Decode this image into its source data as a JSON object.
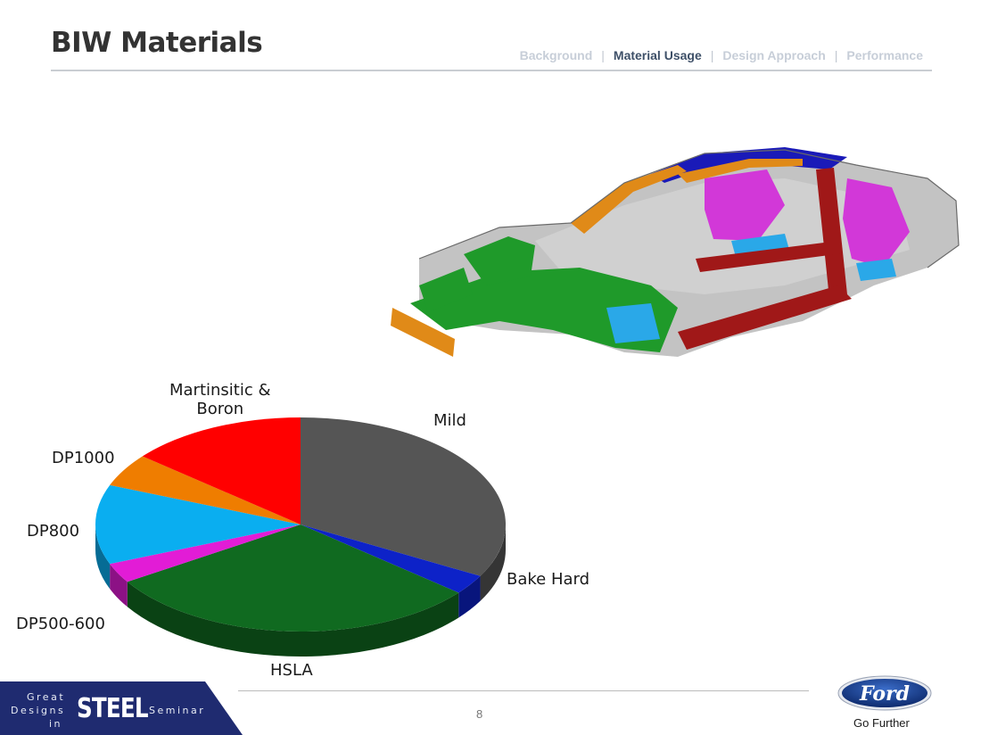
{
  "slide": {
    "title": "BIW Materials",
    "page_number": "8"
  },
  "nav": {
    "items": [
      "Background",
      "Material Usage",
      "Design Approach",
      "Performance"
    ],
    "separator": "|",
    "active_index": 1
  },
  "chart_data": {
    "type": "pie",
    "title": "",
    "style": "3d",
    "slices": [
      {
        "label": "Mild",
        "value": 33,
        "color": "#555555"
      },
      {
        "label": "Bake Hard",
        "value": 3,
        "color": "#0d22c8"
      },
      {
        "label": "HSLA",
        "value": 30,
        "color": "#106a20"
      },
      {
        "label": "DP500-600",
        "value": 3,
        "color": "#e21cd6"
      },
      {
        "label": "DP800",
        "value": 12,
        "color": "#0aaef0"
      },
      {
        "label": "DP1000",
        "value": 5,
        "color": "#ef7d00"
      },
      {
        "label": "Martinsitic &\nBoron",
        "value": 14,
        "color": "#ff0000"
      }
    ],
    "label_lines": {
      "mild": "Mild",
      "bake_hard": "Bake Hard",
      "hsla": "HSLA",
      "dp500": "DP500-600",
      "dp800": "DP800",
      "dp1000": "DP1000",
      "martensitic_1": "Martinsitic &",
      "martensitic_2": "Boron"
    }
  },
  "image": {
    "subject": "car-body-in-white-illustration",
    "colors": {
      "mild": "#9a9a9a",
      "hsla": "#1f9a2a",
      "dp800": "#2aa8e8",
      "dp1000": "#e08a18",
      "boron": "#a01818",
      "bake_hard": "#1a1ab8",
      "dp500": "#d238d8"
    }
  },
  "footer": {
    "badge_great": "Great",
    "badge_designs": "Designs",
    "badge_in": "in",
    "badge_steel": "STEEL",
    "badge_seminar": "Seminar",
    "brand": "Ford",
    "tagline": "Go Further"
  }
}
